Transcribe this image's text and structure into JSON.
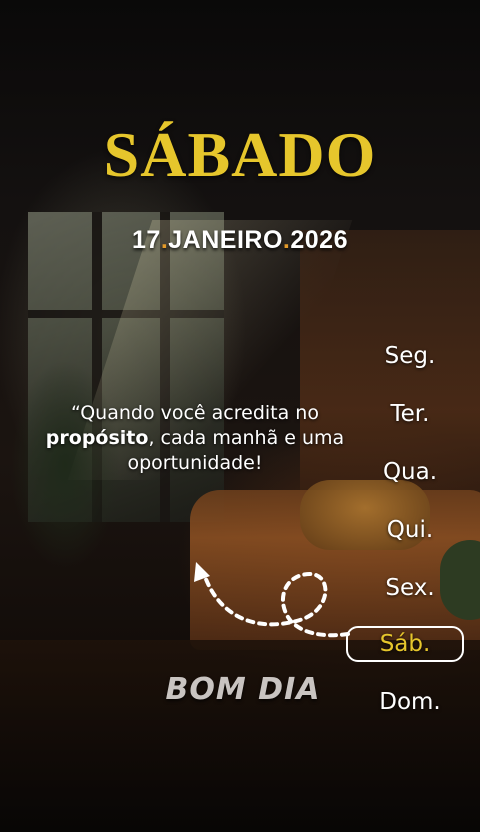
{
  "header": {
    "day_name": "SÁBADO",
    "date_day": "17",
    "date_month": "JANEIRO",
    "date_year": "2026"
  },
  "quote": {
    "part1": "“Quando você acredita no",
    "bold": "propósito",
    "part2": ", cada manhã e uma oportunidade!"
  },
  "days": [
    "Seg.",
    "Ter.",
    "Qua.",
    "Qui.",
    "Sex.",
    "Sáb.",
    "Dom."
  ],
  "active_day_index": 5,
  "greeting": "BOM DIA",
  "colors": {
    "title": "#e6c62c",
    "date_dot": "#e39a2a",
    "active_day": "#e6c62c",
    "greeting": "#c9c4c1"
  }
}
